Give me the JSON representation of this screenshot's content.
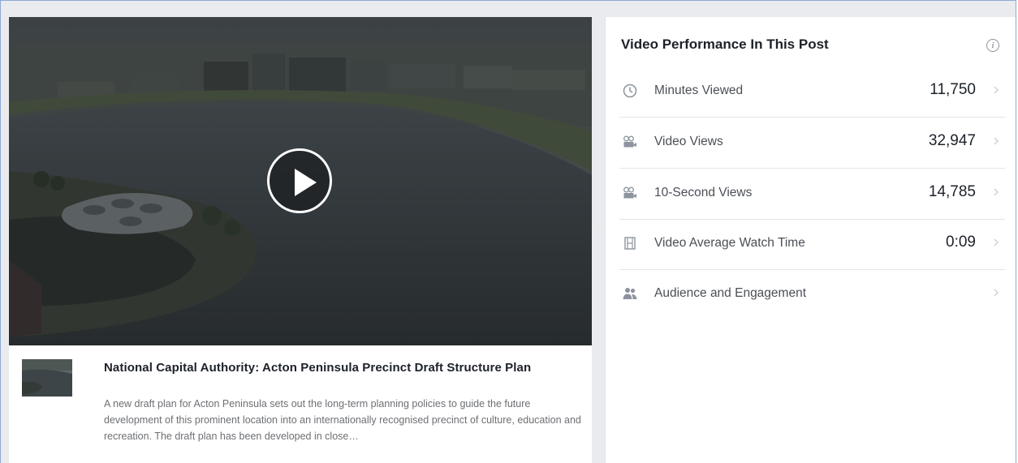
{
  "video": {
    "title": "National Capital Authority: Acton Peninsula Precinct Draft Structure Plan",
    "description": "A new draft plan for Acton Peninsula sets out the long-term planning policies to guide the future development of this prominent location into an internationally recognised precinct of culture, education and recreation. The draft plan has been developed in close…"
  },
  "stats": {
    "title": "Video Performance In This Post",
    "info_glyph": "i",
    "rows": [
      {
        "label": "Minutes Viewed",
        "value": "11,750",
        "icon": "clock-icon"
      },
      {
        "label": "Video Views",
        "value": "32,947",
        "icon": "video-camera-icon"
      },
      {
        "label": "10-Second Views",
        "value": "14,785",
        "icon": "video-camera-icon"
      },
      {
        "label": "Video Average Watch Time",
        "value": "0:09",
        "icon": "film-icon"
      },
      {
        "label": "Audience and Engagement",
        "value": "",
        "icon": "people-icon"
      }
    ]
  },
  "colors": {
    "border_accent": "#8fa8d6",
    "title_text": "#1d2129",
    "muted_text": "#6d6f73",
    "icon_gray": "#8d949e"
  }
}
